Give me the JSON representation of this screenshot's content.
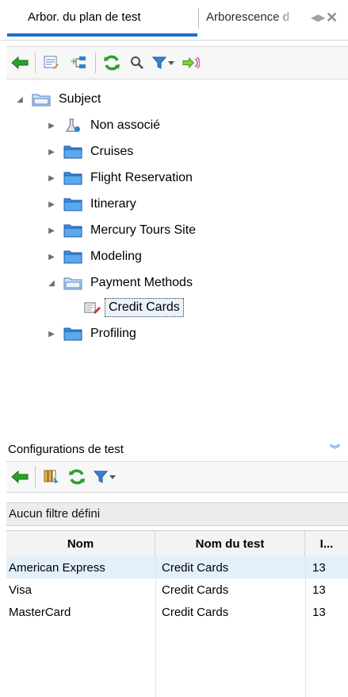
{
  "tabs": {
    "active_label": "Arbor. du plan de test",
    "inactive_label": "Arborescence d"
  },
  "toolbar": {
    "icons": [
      "back-arrow-icon",
      "list-edit-icon",
      "tree-add-icon",
      "refresh-icon",
      "search-icon",
      "filter-icon",
      "filter-dropdown-icon",
      "go-arrow-icon"
    ]
  },
  "tree": {
    "root": "Subject",
    "items": [
      {
        "label": "Non associé",
        "expanded": false
      },
      {
        "label": "Cruises",
        "expanded": false
      },
      {
        "label": "Flight Reservation",
        "expanded": false
      },
      {
        "label": "Itinerary",
        "expanded": false
      },
      {
        "label": "Mercury Tours Site",
        "expanded": false
      },
      {
        "label": "Modeling",
        "expanded": false
      },
      {
        "label": "Payment Methods",
        "expanded": true
      },
      {
        "label": "Credit Cards",
        "selected": true
      },
      {
        "label": "Profiling",
        "expanded": false
      }
    ]
  },
  "config_panel": {
    "title": "Configurations de test",
    "filter_text": "Aucun filtre défini",
    "columns": [
      "Nom",
      "Nom du test",
      "I..."
    ],
    "rows": [
      {
        "nom": "American Express",
        "test": "Credit Cards",
        "id": "13"
      },
      {
        "nom": "Visa",
        "test": "Credit Cards",
        "id": "13"
      },
      {
        "nom": "MasterCard",
        "test": "Credit Cards",
        "id": "13"
      }
    ]
  },
  "colors": {
    "accent": "#1f6fd1",
    "selection": "#e3effa"
  }
}
